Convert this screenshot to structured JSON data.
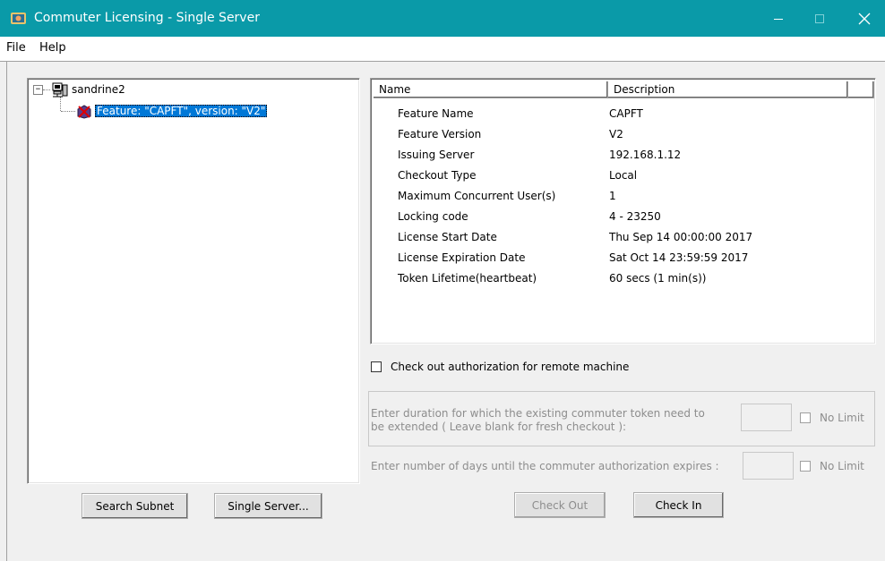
{
  "window": {
    "title": "Commuter Licensing - Single Server"
  },
  "menu": {
    "file": "File",
    "help": "Help"
  },
  "tree": {
    "root_label": "sandrine2",
    "expander": "−",
    "child_label": "Feature: \"CAPFT\", version: \"V2\""
  },
  "details": {
    "columns": {
      "name": "Name",
      "description": "Description"
    },
    "rows": [
      {
        "name": "Feature Name",
        "value": "CAPFT"
      },
      {
        "name": "Feature Version",
        "value": "V2"
      },
      {
        "name": "Issuing Server",
        "value": "192.168.1.12"
      },
      {
        "name": "Checkout Type",
        "value": "Local"
      },
      {
        "name": "Maximum Concurrent User(s)",
        "value": "1"
      },
      {
        "name": "Locking code",
        "value": "4 - 23250"
      },
      {
        "name": "License Start Date",
        "value": "Thu Sep 14 00:00:00 2017"
      },
      {
        "name": "License Expiration Date",
        "value": "Sat Oct 14 23:59:59 2017"
      },
      {
        "name": "Token Lifetime(heartbeat)",
        "value": "60 secs (1 min(s))"
      }
    ]
  },
  "remote_checkout": {
    "label": "Check out authorization for remote machine"
  },
  "extend": {
    "label_line1": "Enter duration for which the existing commuter token need to",
    "label_line2": "be extended ( Leave blank for fresh checkout ):",
    "input_value": "",
    "no_limit": "No Limit"
  },
  "expiry": {
    "label": "Enter number of days until the commuter authorization expires :",
    "input_value": "",
    "no_limit": "No Limit"
  },
  "buttons": {
    "search_subnet": "Search Subnet",
    "single_server": "Single Server...",
    "check_out": "Check Out",
    "check_in": "Check In"
  },
  "colors": {
    "titlebar": "#0a9aa8",
    "selection": "#0078d7"
  }
}
